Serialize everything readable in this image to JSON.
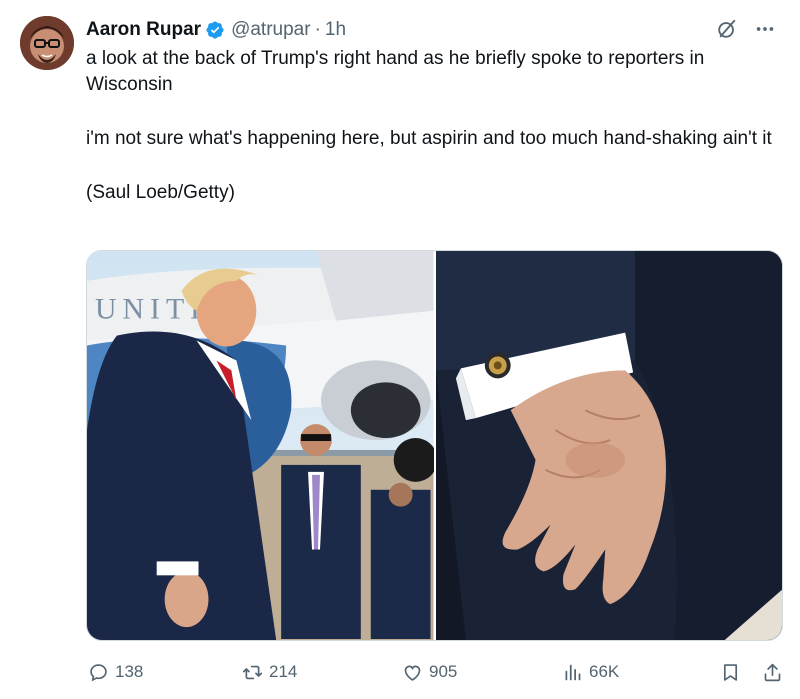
{
  "author": {
    "display_name": "Aaron Rupar",
    "handle": "@atrupar",
    "separator": "·",
    "time": "1h",
    "verified": true
  },
  "tweet": {
    "paragraphs": [
      "a look at the back of Trump's right hand as he briefly spoke to reporters in Wisconsin",
      "i'm not sure what's happening here, but aspirin and too much hand-shaking ain't it",
      "(Saul Loeb/Getty)"
    ]
  },
  "media": {
    "photo_left_plane_text": "UNITED",
    "photos_count": 2
  },
  "actions": {
    "replies": "138",
    "reposts": "214",
    "likes": "905",
    "views": "66K"
  },
  "colors": {
    "text": "#0f1419",
    "secondary": "#536471",
    "verified_blue": "#1d9bf0",
    "border": "#cfd9de"
  },
  "icons": [
    "verified-badge-icon",
    "grok-icon",
    "more-icon",
    "reply-icon",
    "repost-icon",
    "like-icon",
    "views-icon",
    "bookmark-icon",
    "share-icon"
  ]
}
